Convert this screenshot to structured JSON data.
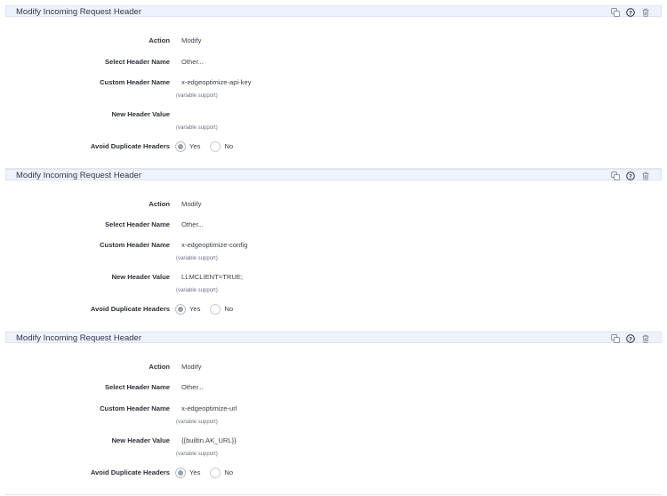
{
  "sections": [
    {
      "title": "Modify Incoming Request Header",
      "action_label": "Action",
      "action_value": "Modify",
      "select_label": "Select Header Name",
      "select_value": "Other...",
      "custom_label": "Custom Header Name",
      "custom_value": "x-edgeoptimize-api-key",
      "custom_hint": "(variable support)",
      "newval_label": "New Header Value",
      "newval_value": "",
      "newval_hint": "(variable support)",
      "dup_label": "Avoid Duplicate Headers",
      "yes_label": "Yes",
      "no_label": "No"
    },
    {
      "title": "Modify Incoming Request Header",
      "action_label": "Action",
      "action_value": "Modify",
      "select_label": "Select Header Name",
      "select_value": "Other...",
      "custom_label": "Custom Header Name",
      "custom_value": "x-edgeoptimize-config",
      "custom_hint": "(variable support)",
      "newval_label": "New Header Value",
      "newval_value": "LLMCLIENT=TRUE;",
      "newval_hint": "(variable support)",
      "dup_label": "Avoid Duplicate Headers",
      "yes_label": "Yes",
      "no_label": "No"
    },
    {
      "title": "Modify Incoming Request Header",
      "action_label": "Action",
      "action_value": "Modify",
      "select_label": "Select Header Name",
      "select_value": "Other...",
      "custom_label": "Custom Header Name",
      "custom_value": "x-edgeoptimize-url",
      "custom_hint": "(variable support)",
      "newval_label": "New Header Value",
      "newval_value": "{{builtin.AK_URL}}",
      "newval_hint": "(variable support)",
      "dup_label": "Avoid Duplicate Headers",
      "yes_label": "Yes",
      "no_label": "No"
    }
  ],
  "icons": [
    "copy-icon",
    "help-icon",
    "trash-icon"
  ],
  "colors": {
    "header_bg": "#eef2fb",
    "text": "#2b2f3a",
    "icon": "#7a808d"
  }
}
